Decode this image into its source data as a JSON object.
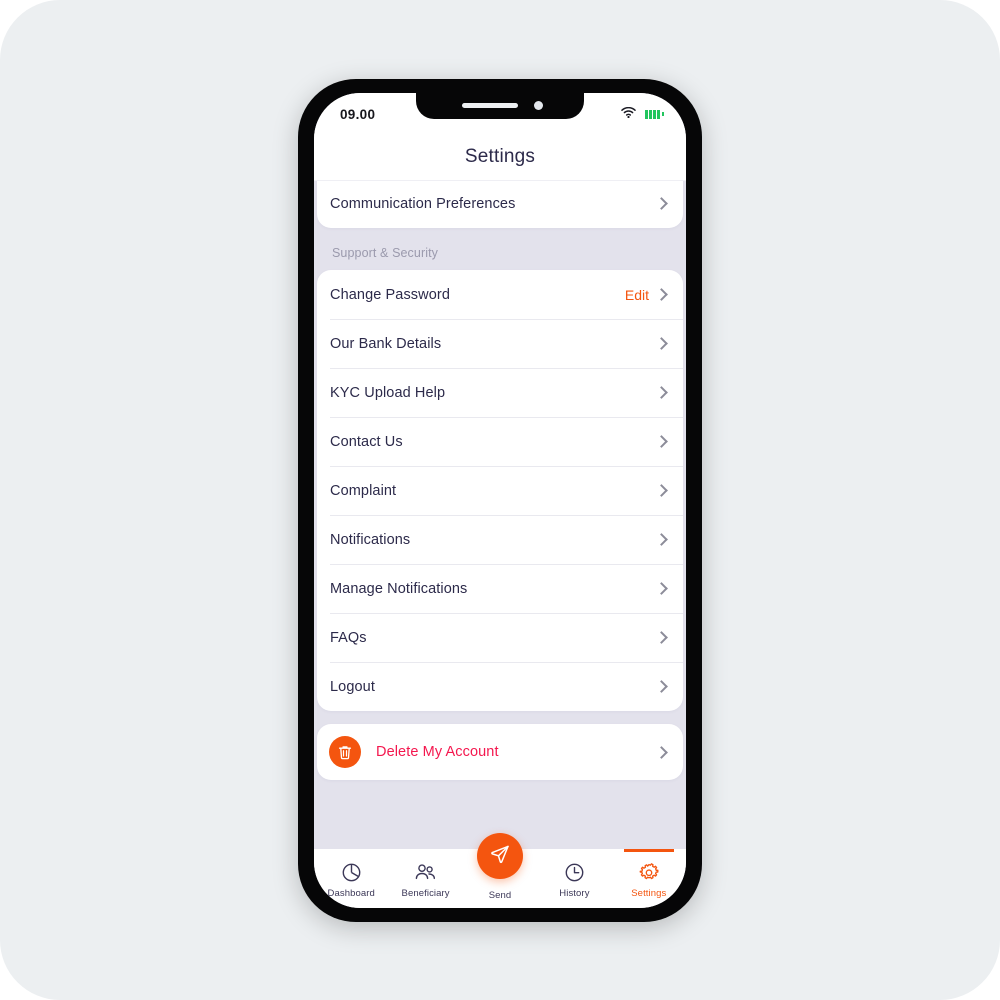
{
  "status_bar": {
    "time": "09.00",
    "wifi_icon": "wifi-icon",
    "battery_icon": "battery-icon"
  },
  "header": {
    "title": "Settings"
  },
  "top_card": {
    "items": [
      {
        "label": "Communication Preferences",
        "icon": "chevron-right-icon"
      }
    ]
  },
  "sections": [
    {
      "heading": "Support & Security",
      "items": [
        {
          "label": "Change Password",
          "action": "Edit",
          "icon": "chevron-right-icon"
        },
        {
          "label": "Our Bank Details",
          "action": "",
          "icon": "chevron-right-icon"
        },
        {
          "label": "KYC Upload Help",
          "action": "",
          "icon": "chevron-right-icon"
        },
        {
          "label": "Contact Us",
          "action": "",
          "icon": "chevron-right-icon"
        },
        {
          "label": "Complaint",
          "action": "",
          "icon": "chevron-right-icon"
        },
        {
          "label": "Notifications",
          "action": "",
          "icon": "chevron-right-icon"
        },
        {
          "label": "Manage Notifications",
          "action": "",
          "icon": "chevron-right-icon"
        },
        {
          "label": "FAQs",
          "action": "",
          "icon": "chevron-right-icon"
        },
        {
          "label": "Logout",
          "action": "",
          "icon": "chevron-right-icon"
        }
      ]
    }
  ],
  "delete_account": {
    "label": "Delete My Account",
    "icon": "trash-icon",
    "chevron": "chevron-right-icon"
  },
  "bottom_nav": {
    "items": [
      {
        "label": "Dashboard",
        "icon": "pie-chart-icon",
        "active": false
      },
      {
        "label": "Beneficiary",
        "icon": "people-icon",
        "active": false
      },
      {
        "label": "Send",
        "icon": "paper-plane-icon",
        "active": false
      },
      {
        "label": "History",
        "icon": "clock-icon",
        "active": false
      },
      {
        "label": "Settings",
        "icon": "gear-icon",
        "active": true
      }
    ]
  },
  "colors": {
    "accent": "#F4550F",
    "danger": "#F4174E",
    "text_primary": "#2C2A4A",
    "text_muted": "#9B9AAD",
    "screen_bg": "#E3E2EC",
    "canvas_bg": "#ECEFF1",
    "battery_green": "#22C55E"
  }
}
